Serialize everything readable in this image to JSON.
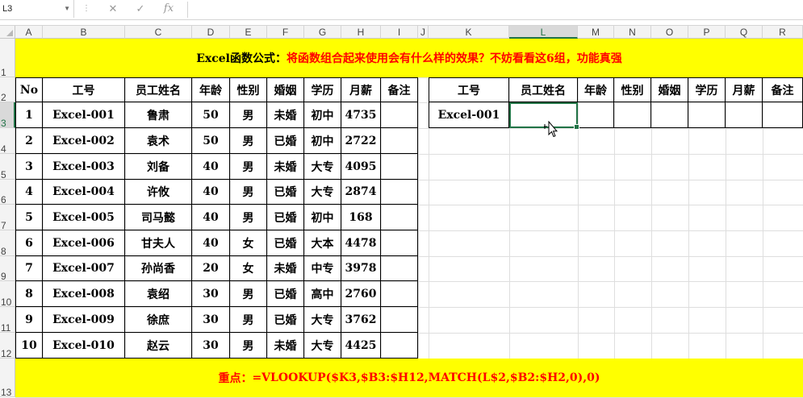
{
  "name_box": {
    "value": "L3"
  },
  "toolbar": {
    "cancel": "✕",
    "enter": "✓",
    "fx": "fx"
  },
  "formula_bar": {
    "value": ""
  },
  "columns": [
    "A",
    "B",
    "C",
    "D",
    "E",
    "F",
    "G",
    "H",
    "I",
    "J",
    "K",
    "L",
    "M",
    "N",
    "O",
    "P",
    "Q",
    "R"
  ],
  "rows": [
    "1",
    "2",
    "3",
    "4",
    "5",
    "6",
    "7",
    "8",
    "9",
    "10",
    "11",
    "12",
    "13"
  ],
  "title": {
    "black": "Excel函数公式：",
    "red": "将函数组合起来使用会有什么样的效果？不妨看看这6组，功能真强"
  },
  "headers": [
    "No",
    "工号",
    "员工姓名",
    "年龄",
    "性别",
    "婚姻",
    "学历",
    "月薪",
    "备注"
  ],
  "records": [
    [
      "1",
      "Excel-001",
      "鲁肃",
      "50",
      "男",
      "未婚",
      "初中",
      "4735",
      ""
    ],
    [
      "2",
      "Excel-002",
      "袁术",
      "50",
      "男",
      "已婚",
      "初中",
      "2722",
      ""
    ],
    [
      "3",
      "Excel-003",
      "刘备",
      "40",
      "男",
      "未婚",
      "大专",
      "4095",
      ""
    ],
    [
      "4",
      "Excel-004",
      "许攸",
      "40",
      "男",
      "已婚",
      "大专",
      "2874",
      ""
    ],
    [
      "5",
      "Excel-005",
      "司马懿",
      "40",
      "男",
      "已婚",
      "初中",
      "168",
      ""
    ],
    [
      "6",
      "Excel-006",
      "甘夫人",
      "40",
      "女",
      "已婚",
      "大本",
      "4478",
      ""
    ],
    [
      "7",
      "Excel-007",
      "孙尚香",
      "20",
      "女",
      "未婚",
      "中专",
      "3978",
      ""
    ],
    [
      "8",
      "Excel-008",
      "袁绍",
      "30",
      "男",
      "已婚",
      "高中",
      "2760",
      ""
    ],
    [
      "9",
      "Excel-009",
      "徐庶",
      "30",
      "男",
      "已婚",
      "大专",
      "3762",
      ""
    ],
    [
      "10",
      "Excel-010",
      "赵云",
      "30",
      "男",
      "未婚",
      "大专",
      "4425",
      ""
    ]
  ],
  "lookup": {
    "headers": [
      "工号",
      "员工姓名",
      "年龄",
      "性别",
      "婚姻",
      "学历",
      "月薪",
      "备注"
    ],
    "values": [
      "Excel-001",
      "",
      "",
      "",
      "",
      "",
      "",
      ""
    ]
  },
  "footer": {
    "black": "重点：",
    "red": "=VLOOKUP($K3,$B3:$H12,MATCH(L$2,$B2:$H2,0),0)"
  },
  "colors": {
    "banner_bg": "#ffff00",
    "accent_red": "#ff0000",
    "selection_green": "#217346"
  }
}
